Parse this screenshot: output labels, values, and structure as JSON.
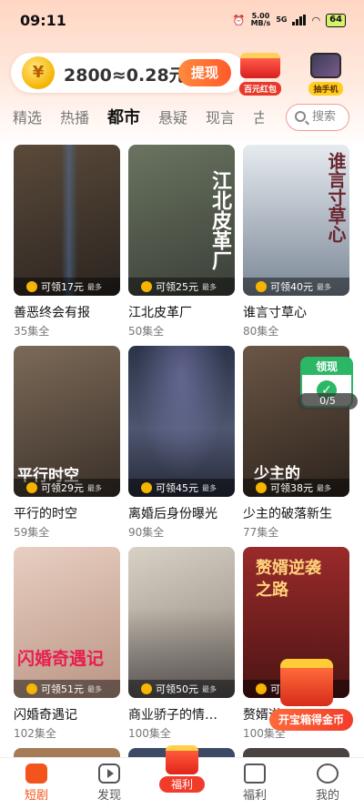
{
  "status_bar": {
    "time": "09:11",
    "net_speed": "5.00",
    "net_unit": "MB/s",
    "network": "5G",
    "battery": "64"
  },
  "header": {
    "coin_symbol": "¥",
    "coin_amount": "2800≈0.28元",
    "withdraw_label": "提现",
    "promo_hongbao": "百元红包",
    "promo_phone": "抽手机"
  },
  "tabs": [
    "精选",
    "热播",
    "都市",
    "悬疑",
    "现言",
    "古"
  ],
  "active_tab": "都市",
  "search": {
    "label": "搜索"
  },
  "cards": [
    {
      "title": "善恶终会有报",
      "eps": "35集全",
      "reward": "可领17元",
      "most": "最多",
      "poster_text": "",
      "bg": "#3a2f26"
    },
    {
      "title": "江北皮革厂",
      "eps": "50集全",
      "reward": "可领25元",
      "most": "最多",
      "poster_text": "江北皮革厂",
      "bg": "#4a5446"
    },
    {
      "title": "谁言寸草心",
      "eps": "80集全",
      "reward": "可领40元",
      "most": "最多",
      "poster_text": "谁言寸草心",
      "bg": "#b9c2cc"
    },
    {
      "title": "平行的时空",
      "eps": "59集全",
      "reward": "可领29元",
      "most": "最多",
      "poster_text": "平行时空",
      "bg": "#5d4f44"
    },
    {
      "title": "离婚后身份曝光",
      "eps": "90集全",
      "reward": "可领45元",
      "most": "最多",
      "poster_text": "",
      "bg": "#3a3e55"
    },
    {
      "title": "少主的破落新生",
      "eps": "77集全",
      "reward": "可领38元",
      "most": "最多",
      "poster_text": "少主的",
      "bg": "#4d3b2f"
    },
    {
      "title": "闪婚奇遇记",
      "eps": "102集全",
      "reward": "可领51元",
      "most": "最多",
      "poster_text": "闪婚奇遇记",
      "bg": "#d9b7a6"
    },
    {
      "title": "商业骄子的情…",
      "eps": "100集全",
      "reward": "可领50元",
      "most": "最多",
      "poster_text": "",
      "bg": "#b4a89b"
    },
    {
      "title": "赘婿逆…",
      "eps": "100集全",
      "reward": "可领",
      "most": "",
      "poster_text": "赘婿逆袭之路",
      "bg": "#7a2a2a"
    }
  ],
  "floating": {
    "lingxian_label": "领现",
    "lingxian_check": "✓",
    "progress": "0/5",
    "chest_button": "开宝箱得金币"
  },
  "bottom_nav": [
    {
      "label": "短剧",
      "icon": "drama-icon"
    },
    {
      "label": "发现",
      "icon": "play-icon"
    },
    {
      "label": "福利",
      "icon": "welfare-chest-icon"
    },
    {
      "label": "福利",
      "icon": "gift-icon"
    },
    {
      "label": "我的",
      "icon": "profile-icon"
    }
  ]
}
